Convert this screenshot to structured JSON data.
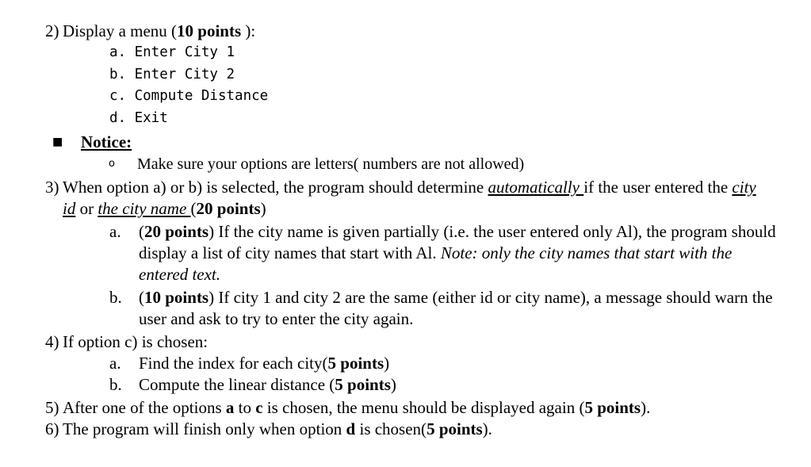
{
  "document": {
    "type": "assignment-requirements-list",
    "background_color": "#ffffff",
    "text_color": "#000000",
    "items": [
      {
        "number": "2)",
        "text_before_points": "Display a menu (",
        "points": "10 points",
        "text_after_points": " ):",
        "menu_options": [
          "a. Enter City 1",
          "b. Enter City 2",
          "c. Compute Distance",
          "d. Exit"
        ],
        "notice": {
          "bullet": "filled-square-bullet",
          "label": "Notice:",
          "sub_bullet": "hollow-circle-bullet",
          "sub_text": "Make sure your options are letters( numbers are not allowed)"
        }
      },
      {
        "number": "3)",
        "seg_1": "When option a) or b) is selected, the program should determine ",
        "seg_2_italic_underline": "automatically ",
        "seg_3": "if the user entered the ",
        "seg_4_italic_underline": "city id",
        "seg_5": " or ",
        "seg_6_italic_underline": "the city name ",
        "seg_7_open": "(",
        "seg_8_bold": "20 points",
        "seg_9_close": ")",
        "sub_items": [
          {
            "marker": "a.",
            "points_open": "(",
            "points": "20 points",
            "points_close": ")",
            "text": " If the city name is given partially (i.e. the user entered only Al), the program should display a list of city names that start with Al. ",
            "note_italic": "Note: only the city names that start with the entered text."
          },
          {
            "marker": "b.",
            "points_open": "(",
            "points": "10 points",
            "points_close": ")",
            "text": " If city 1 and city 2 are the same (either id or city name), a message should warn the user and ask to try to enter the city again.",
            "note_italic": ""
          }
        ]
      },
      {
        "number": "4)",
        "text": "If option c) is chosen:",
        "sub_items": [
          {
            "marker": "a.",
            "text_before_points": "Find the index for each city(",
            "points": "5 points",
            "text_after_points": ")"
          },
          {
            "marker": "b.",
            "text_before_points": "Compute the linear distance (",
            "points": "5 points",
            "text_after_points": ")"
          }
        ]
      },
      {
        "number": "5)",
        "seg_1": "After one of the options ",
        "seg_2_bold": "a",
        "seg_3": " to ",
        "seg_4_bold": "c",
        "seg_5": " is chosen, the menu should be displayed again (",
        "seg_6_bold": "5 points",
        "seg_7": ")."
      },
      {
        "number": "6)",
        "seg_1": "The program will finish only when option ",
        "seg_2_bold": "d",
        "seg_3": " is chosen(",
        "seg_4_bold": "5 points",
        "seg_5": ")."
      }
    ]
  }
}
